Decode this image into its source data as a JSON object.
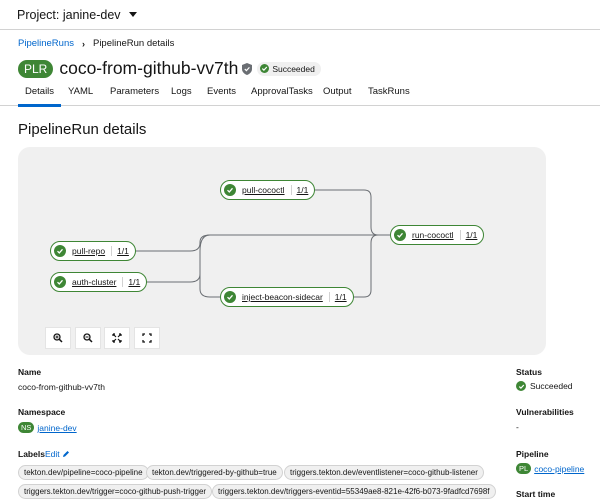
{
  "project": {
    "label": "Project: janine-dev"
  },
  "breadcrumb": {
    "parent": "PipelineRuns",
    "current": "PipelineRun details"
  },
  "header": {
    "badge": "PLR",
    "title": "coco-from-github-vv7th",
    "status": "Succeeded"
  },
  "tabs": [
    "Details",
    "YAML",
    "Parameters",
    "Logs",
    "Events",
    "ApprovalTasks",
    "Output",
    "TaskRuns"
  ],
  "section_title": "PipelineRun details",
  "topology": {
    "nodes": [
      {
        "label": "pull-cococtl",
        "count": "1/1"
      },
      {
        "label": "pull-repo",
        "count": "1/1"
      },
      {
        "label": "auth-cluster",
        "count": "1/1"
      },
      {
        "label": "inject-beacon-sidecar",
        "count": "1/1"
      },
      {
        "label": "run-cococtl",
        "count": "1/1"
      }
    ]
  },
  "details": {
    "name_label": "Name",
    "name_value": "coco-from-github-vv7th",
    "namespace_label": "Namespace",
    "namespace_badge": "NS",
    "namespace_value": "janine-dev",
    "labels_label": "Labels",
    "labels_edit": "Edit",
    "labels": [
      "tekton.dev/pipeline=coco-pipeline",
      "tekton.dev/triggered-by-github=true",
      "triggers.tekton.dev/eventlistener=coco-github-listener",
      "triggers.tekton.dev/trigger=coco-github-push-trigger",
      "triggers.tekton.dev/triggers-eventid=55349ae8-821e-42f6-b073-9fadfcd7698f"
    ]
  },
  "side": {
    "status_label": "Status",
    "status_value": "Succeeded",
    "vuln_label": "Vulnerabilities",
    "vuln_value": "-",
    "pipeline_label": "Pipeline",
    "pipeline_badge": "PL",
    "pipeline_value": "coco-pipeline",
    "start_label": "Start time"
  },
  "colors": {
    "success": "#3e8635",
    "link": "#0066cc",
    "accent": "#0066cc"
  }
}
